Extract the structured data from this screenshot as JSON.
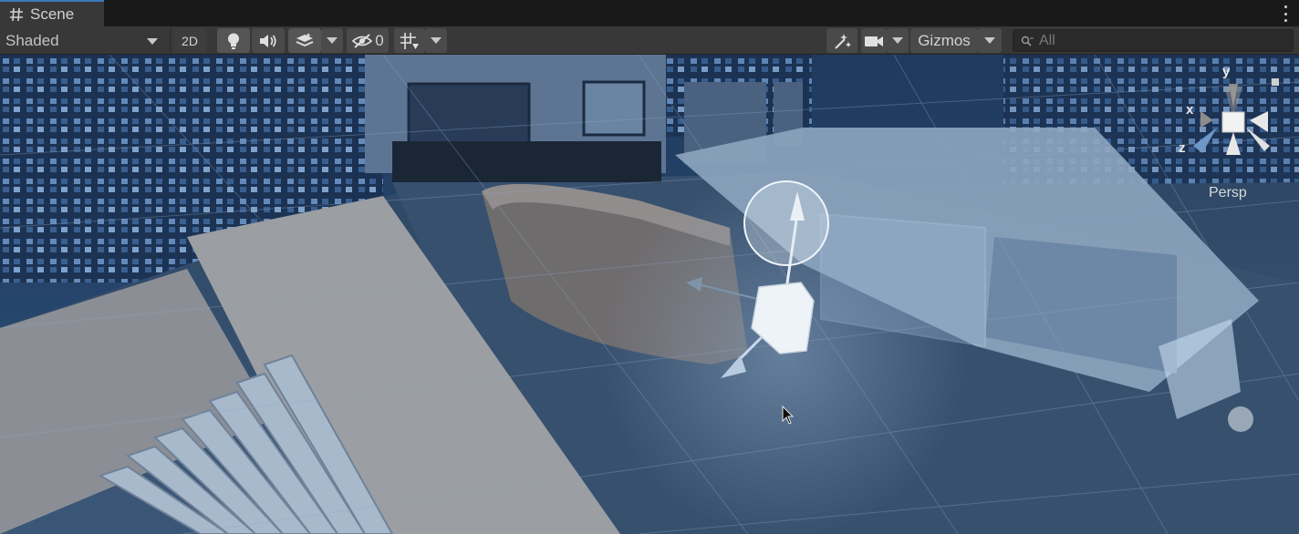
{
  "tab": {
    "title": "Scene",
    "icon": "grid-hash-icon"
  },
  "toolbar": {
    "shading_mode": "Shaded",
    "mode_2d": "2D",
    "hidden_count": "0",
    "gizmos_label": "Gizmos",
    "search_placeholder": "All"
  },
  "orientation_gizmo": {
    "x_label": "x",
    "y_label": "y",
    "z_label": "z",
    "projection_label": "Persp"
  },
  "icons": {
    "lighting": "lightbulb-icon",
    "audio": "speaker-icon",
    "effects": "layers-stack-icon",
    "visibility": "eye-slash-icon",
    "grid_snapping": "grid-snap-icon",
    "tools": "wand-tools-icon",
    "camera": "camera-icon",
    "search": "search-icon",
    "more": "kebab-menu-icon"
  },
  "colors": {
    "accent": "#3a79bb",
    "panel": "#383838",
    "button": "#4a4a4a",
    "scene_sky": "#27456d"
  }
}
